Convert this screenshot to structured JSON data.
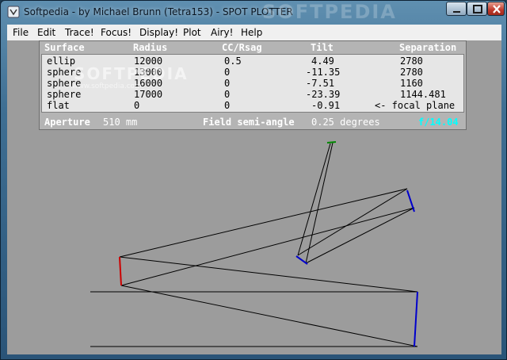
{
  "window": {
    "title": "Softpedia - by Michael Brunn (Tetra153) - SPOT PLOTTER",
    "watermark": "SOFTPEDIA"
  },
  "menu": [
    "File",
    "Edit",
    "Trace!",
    "Focus!",
    "Display!",
    "Plot",
    "Airy!",
    "Help"
  ],
  "table": {
    "headers": [
      "Surface",
      "Radius",
      "CC/Rsag",
      "Tilt",
      "Separation"
    ],
    "rows": [
      [
        "ellip",
        "12000",
        "0.5",
        "4.49",
        "2780"
      ],
      [
        "sphere",
        "13000",
        "0",
        "-11.35",
        "2780"
      ],
      [
        "sphere",
        "16000",
        "0",
        "-7.51",
        "1160"
      ],
      [
        "sphere",
        "17000",
        "0",
        "-23.39",
        "1144.481"
      ],
      [
        "flat",
        "0",
        "0",
        "-0.91",
        "<- focal plane"
      ]
    ],
    "watermark": "SOFTPEDIA",
    "watermark_url": "www.softpedia.com"
  },
  "footer": {
    "aperture_label": "Aperture",
    "aperture_value": "510 mm",
    "field_label": "Field semi-angle",
    "field_value": "0.25 degrees",
    "f_ratio": "f/14.04"
  },
  "colors": {
    "mirror1": "#cc0000",
    "mirror2": "#0000cc",
    "mirror3": "#0000cc",
    "mirror4": "#0000cc",
    "focal_plane": "#008800",
    "rays": "#000000",
    "f_ratio": "#00ffff"
  },
  "icons": {
    "app": "plotter-app-icon",
    "minimize": "minimize-icon",
    "maximize": "maximize-icon",
    "close": "close-icon"
  }
}
